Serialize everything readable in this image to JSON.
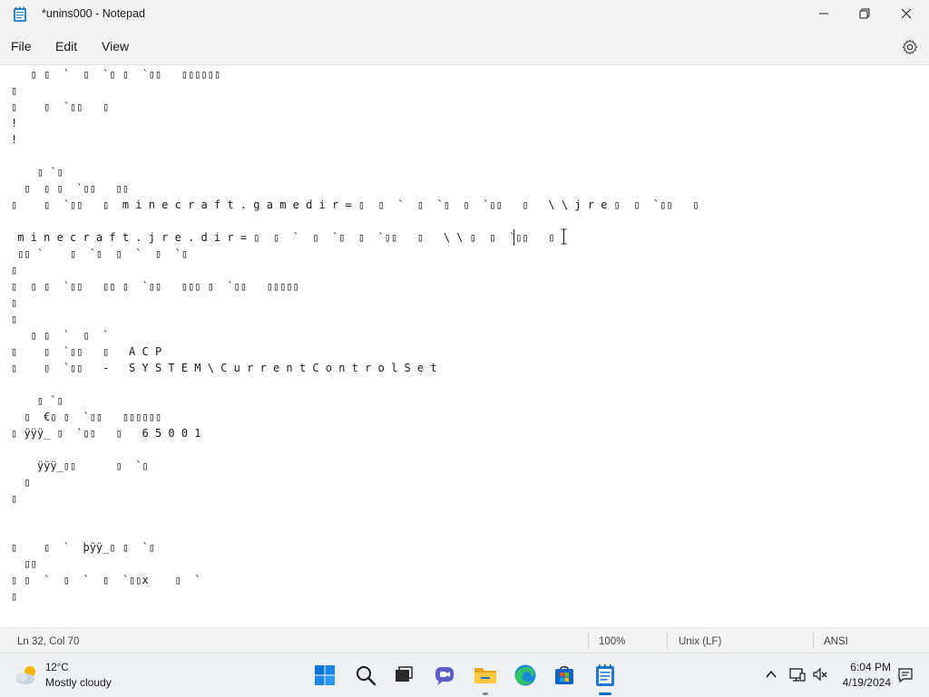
{
  "window": {
    "title": "*unins000 - Notepad",
    "minimize_icon": "minimize-icon",
    "maximize_icon": "restore-icon",
    "close_icon": "close-icon"
  },
  "menu": {
    "file": "File",
    "edit": "Edit",
    "view": "View",
    "settings_icon": "gear-icon"
  },
  "editor": {
    "content": "   ▯ ▯  `  ▯  `▯ ▯  `▯▯   ▯▯▯▯▯▯\n▯\n▯    ▯  `▯▯   ▯\n!\n!\n\n    ▯ `▯\n  ▯  ▯ ▯  `▯▯   ▯▯\n▯    ▯  `▯▯   ▯  m i n e c r a f t . g a m e d i r = ▯  ▯  `  ▯  `▯  ▯  `▯▯   ▯   \\ \\ j r e ▯  ▯  `▯▯   ▯\n\n m i n e c r a f t . j r e . d i r = ▯  ▯  `  ▯  `▯  ▯  `▯▯   ▯   \\ \\ ▯  ▯  `▯▯   ▯\n ▯▯ `    ▯  `▯  ▯  `  ▯  `▯\n▯\n▯  ▯ ▯  `▯▯   ▯▯ ▯  `▯▯   ▯▯▯ ▯  `▯▯   ▯▯▯▯▯\n▯\n▯\n   ▯ ▯  `  ▯  `\n▯    ▯  `▯▯   ▯   A C P\n▯    ▯  `▯▯   -   S Y S T E M \\ C u r r e n t C o n t r o l S e t\n\n    ▯ `▯\n  ▯  €▯ ▯  `▯▯   ▯▯▯▯▯▯\n▯ ÿÿÿ_ ▯  `▯▯   ▯   6 5 0 0 1\n\n    ÿÿÿ_▯▯      ▯  `▯\n  ▯\n▯\n\n\n▯    ▯  `  þÿÿ_▯ ▯  `▯\n  ▯▯\n▯ ▯  `  ▯  `  ▯  `▯▯x    ▯  `\n▯"
  },
  "status": {
    "position": "Ln 32, Col 70",
    "zoom": "100%",
    "line_ending": "Unix (LF)",
    "encoding": "ANSI"
  },
  "taskbar": {
    "weather_temp": "12°C",
    "weather_desc": "Mostly cloudy",
    "weather_icon": "partly-cloudy-icon",
    "apps": [
      "start-icon",
      "search-icon",
      "task-view-icon",
      "chat-icon",
      "file-explorer-icon",
      "edge-icon",
      "store-icon",
      "notepad-icon"
    ],
    "tray": [
      "chevron-up-icon",
      "network-icon",
      "volume-muted-icon",
      "notification-icon"
    ],
    "time": "6:04 PM",
    "date": "4/19/2024"
  },
  "colors": {
    "accent": "#0067c0",
    "editor_bg": "#ffffff",
    "chrome_bg": "#f3f3f3"
  }
}
